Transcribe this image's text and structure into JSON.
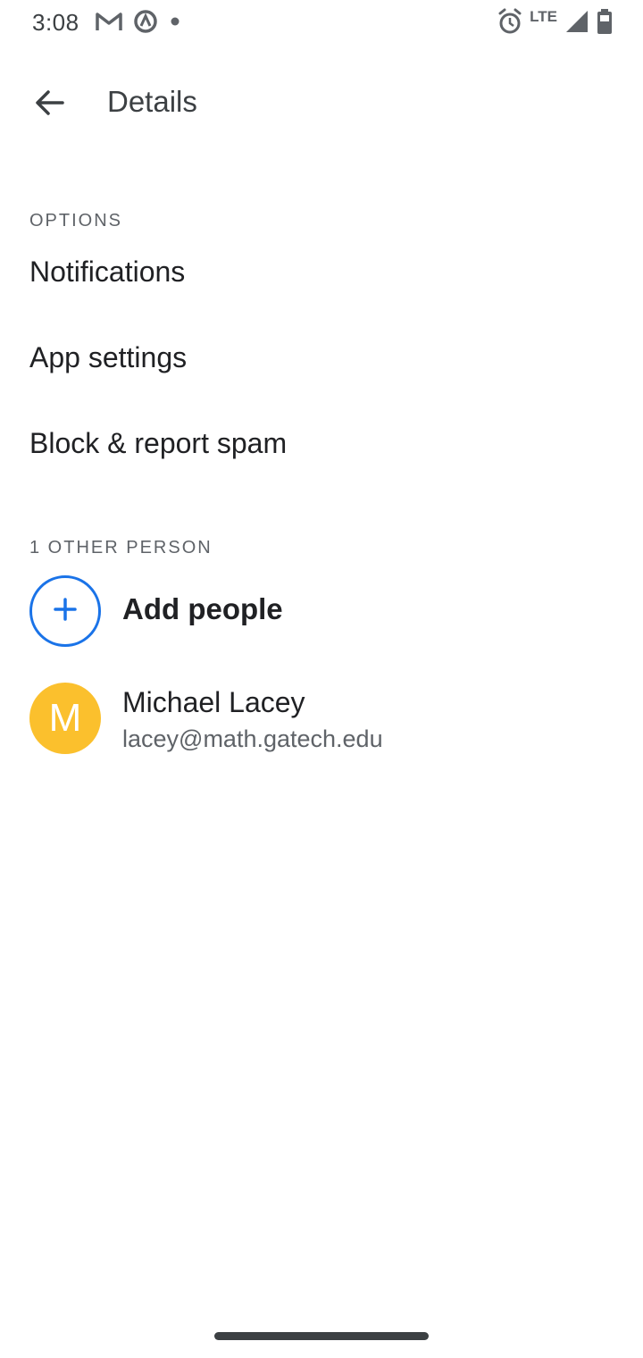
{
  "status_bar": {
    "time": "3:08",
    "left_icons": [
      "gmail-icon",
      "data-saver-icon",
      "notification-dot-icon"
    ],
    "right_icons": [
      "alarm-icon",
      "lte-icon",
      "signal-icon",
      "battery-icon"
    ],
    "network_label": "LTE"
  },
  "app_bar": {
    "back_icon": "back-arrow-icon",
    "title": "Details"
  },
  "options": {
    "header": "OPTIONS",
    "items": [
      {
        "label": "Notifications"
      },
      {
        "label": "App settings"
      },
      {
        "label": "Block & report spam"
      }
    ]
  },
  "people": {
    "header": "1 OTHER PERSON",
    "add_label": "Add people",
    "add_icon": "add-icon",
    "members": [
      {
        "initial": "M",
        "name": "Michael Lacey",
        "email": "lacey@math.gatech.edu"
      }
    ]
  },
  "colors": {
    "accent": "#1a73e8",
    "avatar": "#fbc02d",
    "text_primary": "#202124",
    "text_secondary": "#5f6368"
  }
}
